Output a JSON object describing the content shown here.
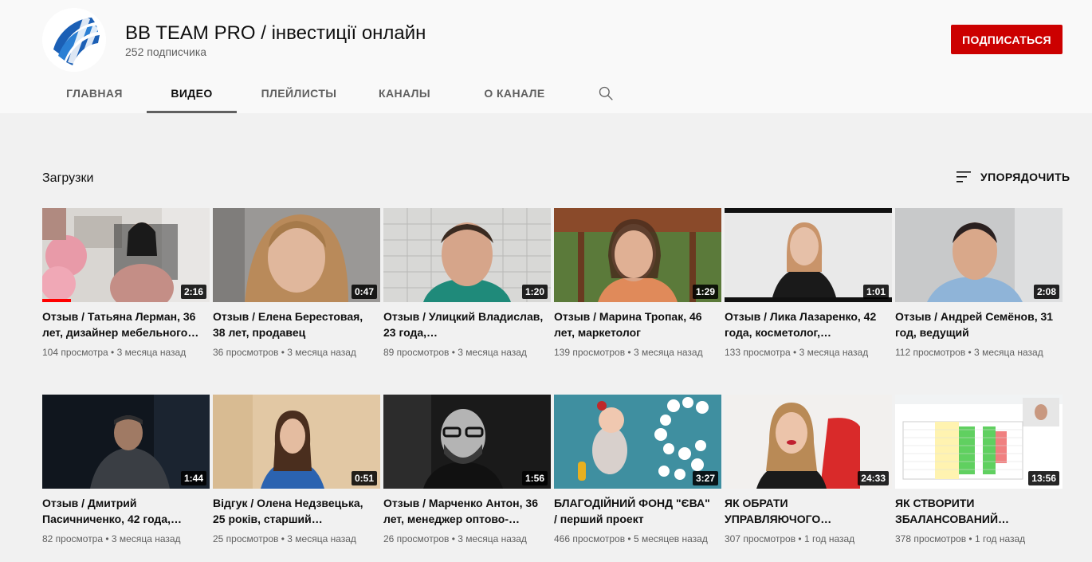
{
  "channel": {
    "name": "BB TEAM PRO / інвестиції онлайн",
    "subscribers": "252 подписчика",
    "subscribe_label": "ПОДПИСАТЬСЯ",
    "avatar_icon": "bb-team-logo-icon"
  },
  "tabs": [
    {
      "label": "ГЛАВНАЯ",
      "active": false
    },
    {
      "label": "ВИДЕО",
      "active": true
    },
    {
      "label": "ПЛЕЙЛИСТЫ",
      "active": false
    },
    {
      "label": "КАНАЛЫ",
      "active": false
    },
    {
      "label": "О КАНАЛЕ",
      "active": false
    }
  ],
  "section": {
    "title": "Загрузки",
    "sort_label": "УПОРЯДОЧИТЬ"
  },
  "videos": [
    {
      "title": "Отзыв / Татьяна Лерман, 36 лет, дизайнер мебельного…",
      "duration": "2:16",
      "meta": "104 просмотра • 3 месяца назад",
      "watched": 0.17
    },
    {
      "title": "Отзыв / Елена Берестовая, 38 лет, продавец",
      "duration": "0:47",
      "meta": "36 просмотров • 3 месяца назад"
    },
    {
      "title": "Отзыв / Улицкий Владислав, 23 года,…",
      "duration": "1:20",
      "meta": "89 просмотров • 3 месяца назад"
    },
    {
      "title": "Отзыв / Марина Тропак, 46 лет, маркетолог",
      "duration": "1:29",
      "meta": "139 просмотров • 3 месяца назад"
    },
    {
      "title": "Отзыв / Лика Лазаренко, 42 года, косметолог,…",
      "duration": "1:01",
      "meta": "133 просмотра • 3 месяца назад"
    },
    {
      "title": "Отзыв / Андрей Семёнов, 31 год, ведущий",
      "duration": "2:08",
      "meta": "112 просмотров • 3 месяца назад"
    },
    {
      "title": "Отзыв / Дмитрий Пасичниченко, 42 года,…",
      "duration": "1:44",
      "meta": "82 просмотра • 3 месяца назад"
    },
    {
      "title": "Відгук / Олена Недзвецька, 25 років, старший…",
      "duration": "0:51",
      "meta": "25 просмотров • 3 месяца назад"
    },
    {
      "title": "Отзыв / Марченко Антон, 36 лет, менеджер оптово-…",
      "duration": "1:56",
      "meta": "26 просмотров • 3 месяца назад"
    },
    {
      "title": "БЛАГОДІЙНИЙ ФОНД \"ЄВА\" / перший проект",
      "duration": "3:27",
      "meta": "466 просмотров • 5 месяцев назад"
    },
    {
      "title": "ЯК ОБРАТИ УПРАВЛЯЮЧОГО…",
      "duration": "24:33",
      "meta": "307 просмотров • 1 год назад"
    },
    {
      "title": "ЯК СТВОРИТИ ЗБАЛАНСОВАНИЙ…",
      "duration": "13:56",
      "meta": "378 просмотров • 1 год назад"
    }
  ]
}
